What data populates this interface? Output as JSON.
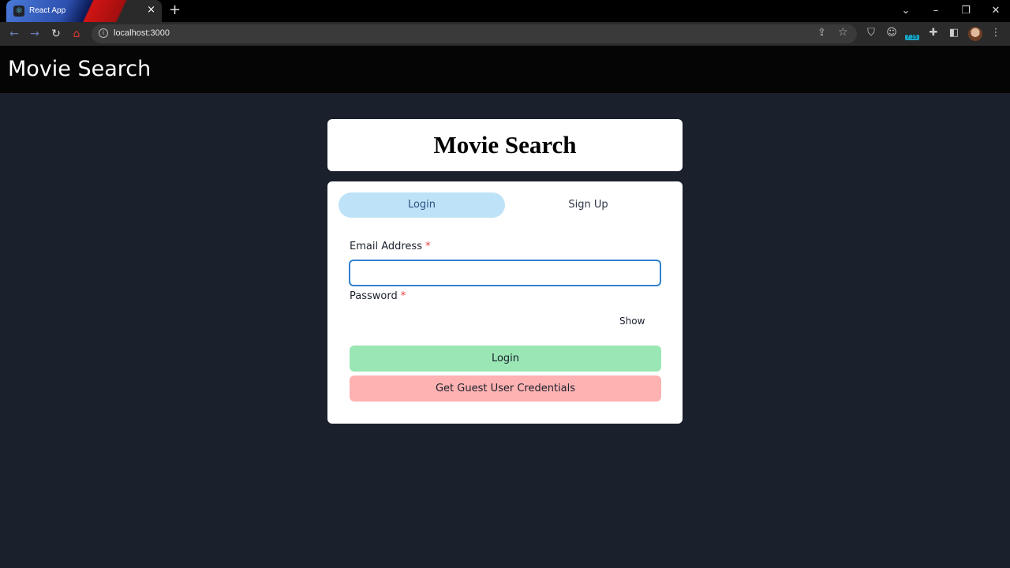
{
  "browser": {
    "tab_title": "React App",
    "tab_icon": "react-icon",
    "url": "localhost:3000",
    "extension_badge": "7:15"
  },
  "header": {
    "title": "Movie Search"
  },
  "title_card": {
    "title": "Movie Search"
  },
  "auth": {
    "tabs": [
      {
        "label": "Login",
        "active": true
      },
      {
        "label": "Sign Up",
        "active": false
      }
    ],
    "email_label": "Email Address",
    "password_label": "Password",
    "required_mark": "*",
    "email_value": "",
    "password_value": "",
    "show_label": "Show",
    "login_button": "Login",
    "guest_button": "Get Guest User Credentials"
  },
  "colors": {
    "page_bg": "#1a202c",
    "active_tab": "#bee3f8",
    "login_button": "#9ae6b4",
    "guest_button": "#feb2b2",
    "focus_border": "#3182ce"
  }
}
